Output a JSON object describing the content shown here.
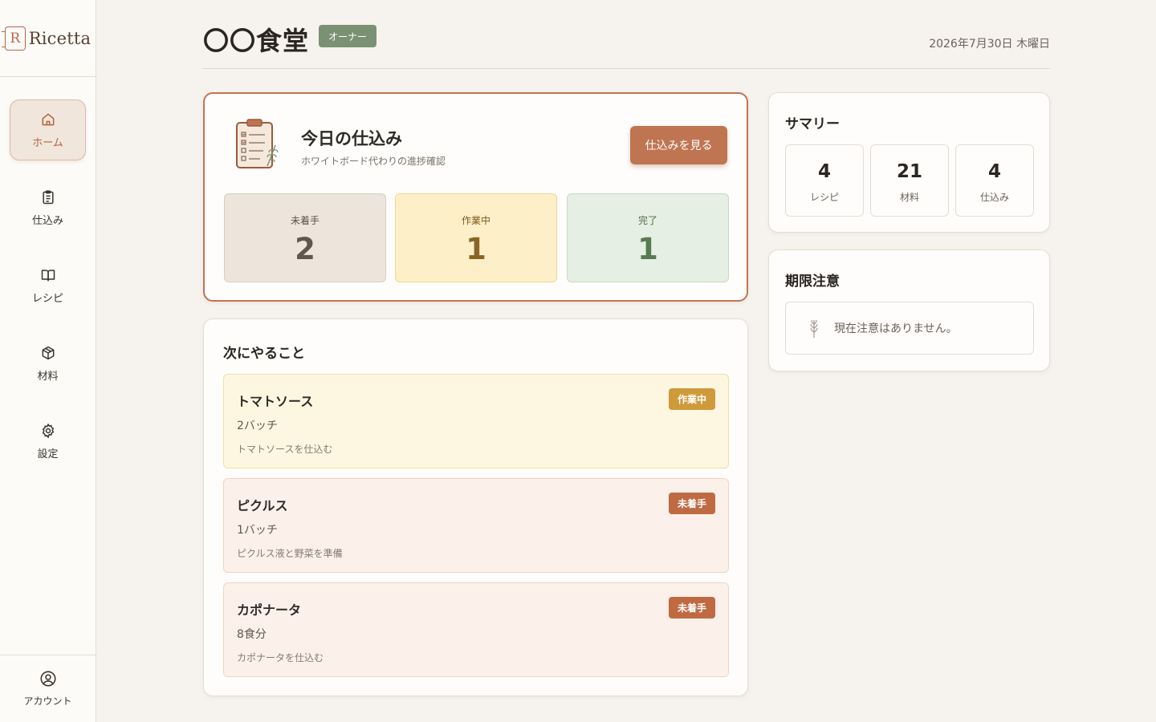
{
  "app": {
    "logo_text": "Ricetta",
    "logo_mark": "R"
  },
  "sidebar": {
    "items": [
      {
        "label": "ホーム",
        "icon": "home-icon",
        "active": true
      },
      {
        "label": "仕込み",
        "icon": "clipboard-icon"
      },
      {
        "label": "レシピ",
        "icon": "book-icon"
      },
      {
        "label": "材料",
        "icon": "package-icon"
      },
      {
        "label": "設定",
        "icon": "gear-icon"
      }
    ],
    "account_label": "アカウント"
  },
  "header": {
    "store_name": "〇〇食堂",
    "role_badge": "オーナー",
    "date": "2026年7月30日 木曜日"
  },
  "prep": {
    "title": "今日の仕込み",
    "subtitle": "ホワイトボード代わりの進捗確認",
    "button_label": "仕込みを見る",
    "stats": [
      {
        "label": "未着手",
        "value": "2"
      },
      {
        "label": "作業中",
        "value": "1"
      },
      {
        "label": "完了",
        "value": "1"
      }
    ]
  },
  "next": {
    "title": "次にやること",
    "tasks": [
      {
        "name": "トマトソース",
        "qty": "2バッチ",
        "desc": "トマトソースを仕込む",
        "status": "作業中"
      },
      {
        "name": "ピクルス",
        "qty": "1バッチ",
        "desc": "ピクルス液と野菜を準備",
        "status": "未着手"
      },
      {
        "name": "カポナータ",
        "qty": "8食分",
        "desc": "カポナータを仕込む",
        "status": "未着手"
      }
    ]
  },
  "summary": {
    "title": "サマリー",
    "items": [
      {
        "value": "4",
        "label": "レシピ"
      },
      {
        "value": "21",
        "label": "材料"
      },
      {
        "value": "4",
        "label": "仕込み"
      }
    ]
  },
  "alerts": {
    "title": "期限注意",
    "empty_message": "現在注意はありません。"
  },
  "colors": {
    "accent": "#c07552",
    "owner_badge": "#7a9173",
    "status_doing": "#cf9a3a",
    "status_todo": "#bf6a42"
  }
}
